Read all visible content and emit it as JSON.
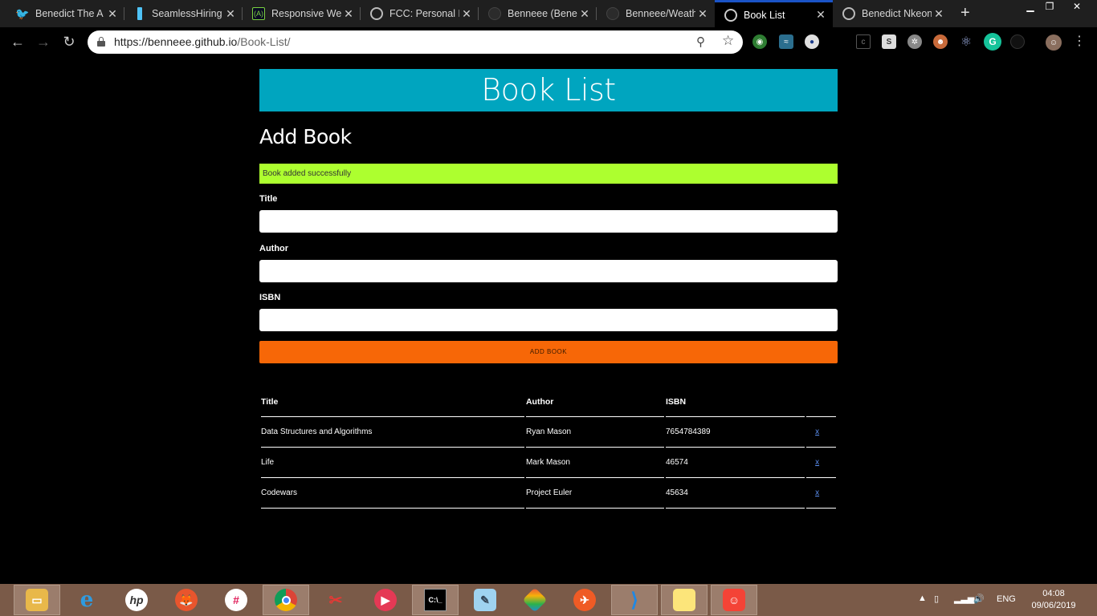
{
  "browser": {
    "tabs": [
      {
        "title": "Benedict The A",
        "icon": "twitter-icon",
        "color": "#1da1f2",
        "active": false
      },
      {
        "title": "SeamlessHiring",
        "icon": "seamless-icon",
        "color": "#4fc3f7",
        "active": false
      },
      {
        "title": "Responsive We",
        "icon": "freecodecamp-icon",
        "color": "#0a0a23",
        "active": false
      },
      {
        "title": "FCC: Personal P",
        "icon": "globe-icon",
        "color": "#9e9e9e",
        "active": false
      },
      {
        "title": "Benneee (Bene",
        "icon": "github-icon",
        "color": "#333333",
        "active": false
      },
      {
        "title": "Benneee/Weath",
        "icon": "github-icon",
        "color": "#333333",
        "active": false
      },
      {
        "title": "Book List",
        "icon": "globe-icon",
        "color": "#9e9e9e",
        "active": true
      },
      {
        "title": "Benedict Nkeon",
        "icon": "globe-icon",
        "color": "#9e9e9e",
        "active": false
      }
    ],
    "url_host": "https://benneee.github.io",
    "url_path": "/Book-List/"
  },
  "page": {
    "header_title": "Book List",
    "form_heading": "Add Book",
    "alert_message": "Book added successfully",
    "alert_color": "#adff2f",
    "header_color": "#00a5bf",
    "button_color": "#f76707",
    "fields": [
      {
        "label": "Title",
        "value": ""
      },
      {
        "label": "Author",
        "value": ""
      },
      {
        "label": "ISBN",
        "value": ""
      }
    ],
    "submit_label": "ADD BOOK",
    "table": {
      "headers": [
        "Title",
        "Author",
        "ISBN",
        ""
      ],
      "rows": [
        {
          "title": "Data Structures and Algorithms",
          "author": "Ryan Mason",
          "isbn": "7654784389",
          "delete": "x"
        },
        {
          "title": "Life",
          "author": "Mark Mason",
          "isbn": "46574",
          "delete": "x"
        },
        {
          "title": "Codewars",
          "author": "Project Euler",
          "isbn": "45634",
          "delete": "x"
        }
      ]
    }
  },
  "taskbar": {
    "apps": [
      "file-explorer-icon",
      "internet-explorer-icon",
      "hp-icon",
      "firefox-icon",
      "slack-icon",
      "chrome-icon",
      "snipping-tool-icon",
      "youtube-music-icon",
      "cmd-icon",
      "notepad-icon",
      "gitkraken-icon",
      "postman-icon",
      "vscode-icon",
      "sticky-notes-icon",
      "bitmoji-icon"
    ],
    "language": "ENG",
    "time": "04:08",
    "date": "09/06/2019"
  }
}
